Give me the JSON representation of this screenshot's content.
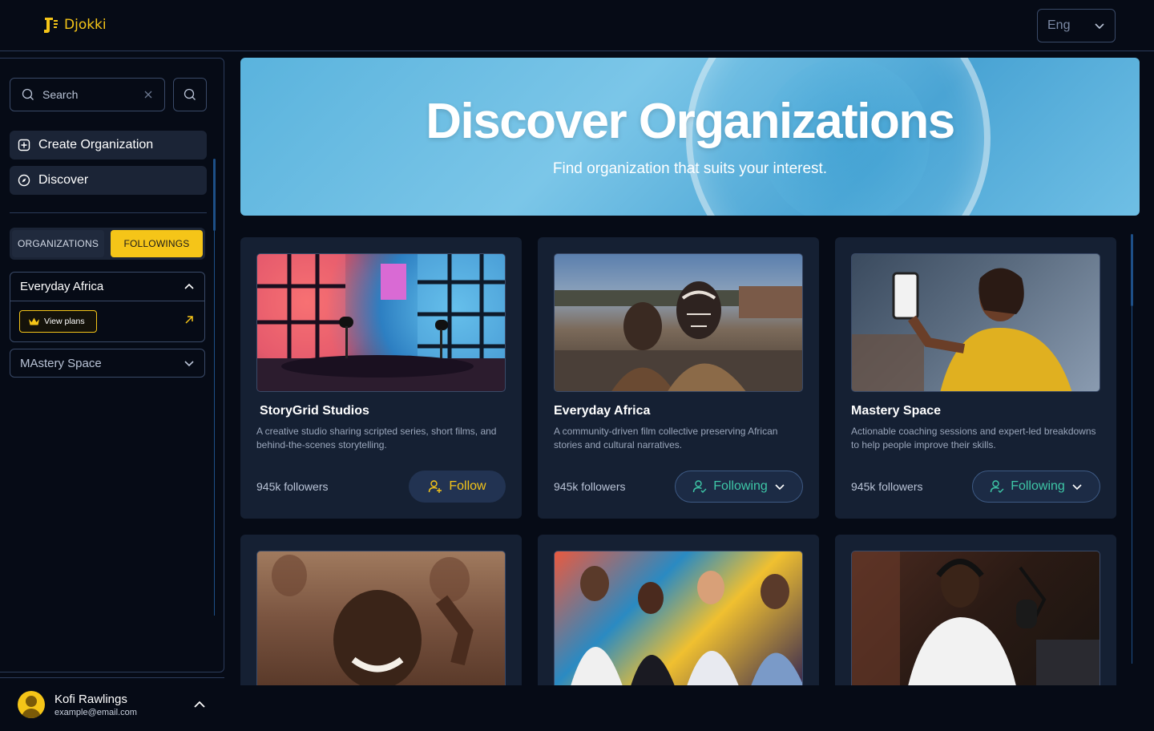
{
  "app": {
    "brand": "Djokki",
    "language": "Eng"
  },
  "sidebar": {
    "search_placeholder": "Search",
    "nav": {
      "create": "Create Organization",
      "discover": "Discover"
    },
    "tabs": {
      "organizations": "ORGANIZATIONS",
      "followings": "FOLLOWINGS",
      "active": "followings"
    },
    "groups": [
      {
        "name": "Everyday Africa",
        "expanded": true,
        "plans_label": "View plans"
      },
      {
        "name": "MAstery Space",
        "expanded": false
      }
    ],
    "user": {
      "name": "Kofi Rawlings",
      "email": "example@email.com"
    }
  },
  "hero": {
    "title": "Discover Organizations",
    "subtitle": "Find organization that suits your interest."
  },
  "organizations": [
    {
      "name": "StoryGrid Studios",
      "description": "A creative studio sharing scripted series, short films, and behind-the-scenes storytelling.",
      "followers": "945k  followers",
      "action": "Follow"
    },
    {
      "name": "Everyday Africa",
      "description": "A community-driven film collective preserving African stories and cultural narratives.",
      "followers": "945k  followers",
      "action": "Following"
    },
    {
      "name": "Mastery Space",
      "description": "Actionable coaching sessions and expert-led breakdowns to help people improve their skills.",
      "followers": "945k  followers",
      "action": "Following"
    }
  ],
  "colors": {
    "accent": "#f5c518",
    "following": "#3ec7a7",
    "background": "#060b16",
    "card": "#152033"
  }
}
